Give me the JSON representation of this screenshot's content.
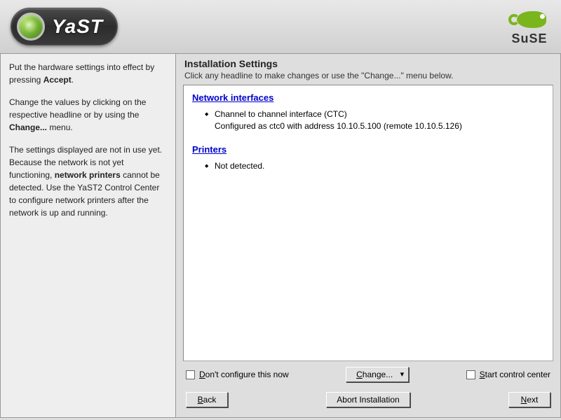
{
  "header": {
    "app_name": "YaST",
    "distro": "SuSE"
  },
  "help": {
    "p1_a": "Put the hardware settings into effect by pressing ",
    "p1_b": "Accept",
    "p1_c": ".",
    "p2_a": "Change the values by clicking on the respective headline or by using the ",
    "p2_b": "Change...",
    "p2_c": " menu.",
    "p3_a": "The settings displayed are not in use yet. Because the network is not yet functioning, ",
    "p3_b": "network printers",
    "p3_c": " cannot be detected. Use the YaST2 Control Center to configure network printers after the network is up and running."
  },
  "content": {
    "title": "Installation Settings",
    "subtitle": "Click any headline to make changes or use the \"Change...\" menu below.",
    "sections": {
      "network": {
        "heading": "Network interfaces",
        "item1": "Channel to channel interface (CTC)",
        "item1_detail": "Configured as ctc0 with address 10.10.5.100 (remote 10.10.5.126)"
      },
      "printers": {
        "heading": "Printers",
        "item1": "Not detected."
      }
    }
  },
  "options": {
    "dont_configure_pre": "D",
    "dont_configure_rest": "on't configure this now",
    "change_pre": "C",
    "change_rest": "hange...",
    "start_cc_pre": "S",
    "start_cc_rest": "tart control center"
  },
  "buttons": {
    "back_pre": "B",
    "back_rest": "ack",
    "abort": "Abort Installation",
    "next_pre": "N",
    "next_rest": "ext"
  }
}
